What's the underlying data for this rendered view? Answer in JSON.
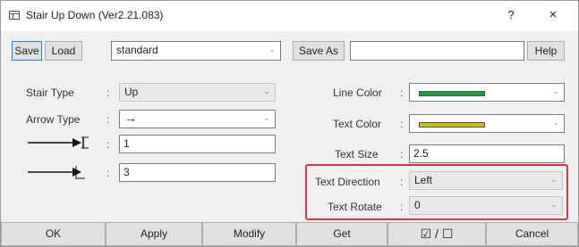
{
  "window": {
    "title": "Stair Up Down (Ver2.21.083)",
    "help_glyph": "?",
    "close_glyph": "×"
  },
  "toolbar": {
    "save_label": "Save",
    "load_label": "Load",
    "preset_value": "standard",
    "saveas_label": "Save As",
    "saveas_value": "",
    "help_label": "Help"
  },
  "left": {
    "stair_type_label": "Stair Type",
    "stair_type_value": "Up",
    "arrow_type_label": "Arrow Type",
    "arrow_type_value": "→",
    "size1_value": "1",
    "size2_value": "3"
  },
  "right": {
    "line_color_label": "Line Color",
    "line_color_swatch": "#1e9e3e",
    "text_color_label": "Text Color",
    "text_color_swatch": "#c9c000",
    "text_size_label": "Text Size",
    "text_size_value": "2.5",
    "text_direction_label": "Text Direction",
    "text_direction_value": "Left",
    "text_rotate_label": "Text Rotate",
    "text_rotate_value": "0"
  },
  "colon": ":",
  "bottom": {
    "ok_label": "OK",
    "apply_label": "Apply",
    "modify_label": "Modify",
    "get_label": "Get",
    "toggle_label": "☑ / ☐",
    "cancel_label": "Cancel"
  }
}
